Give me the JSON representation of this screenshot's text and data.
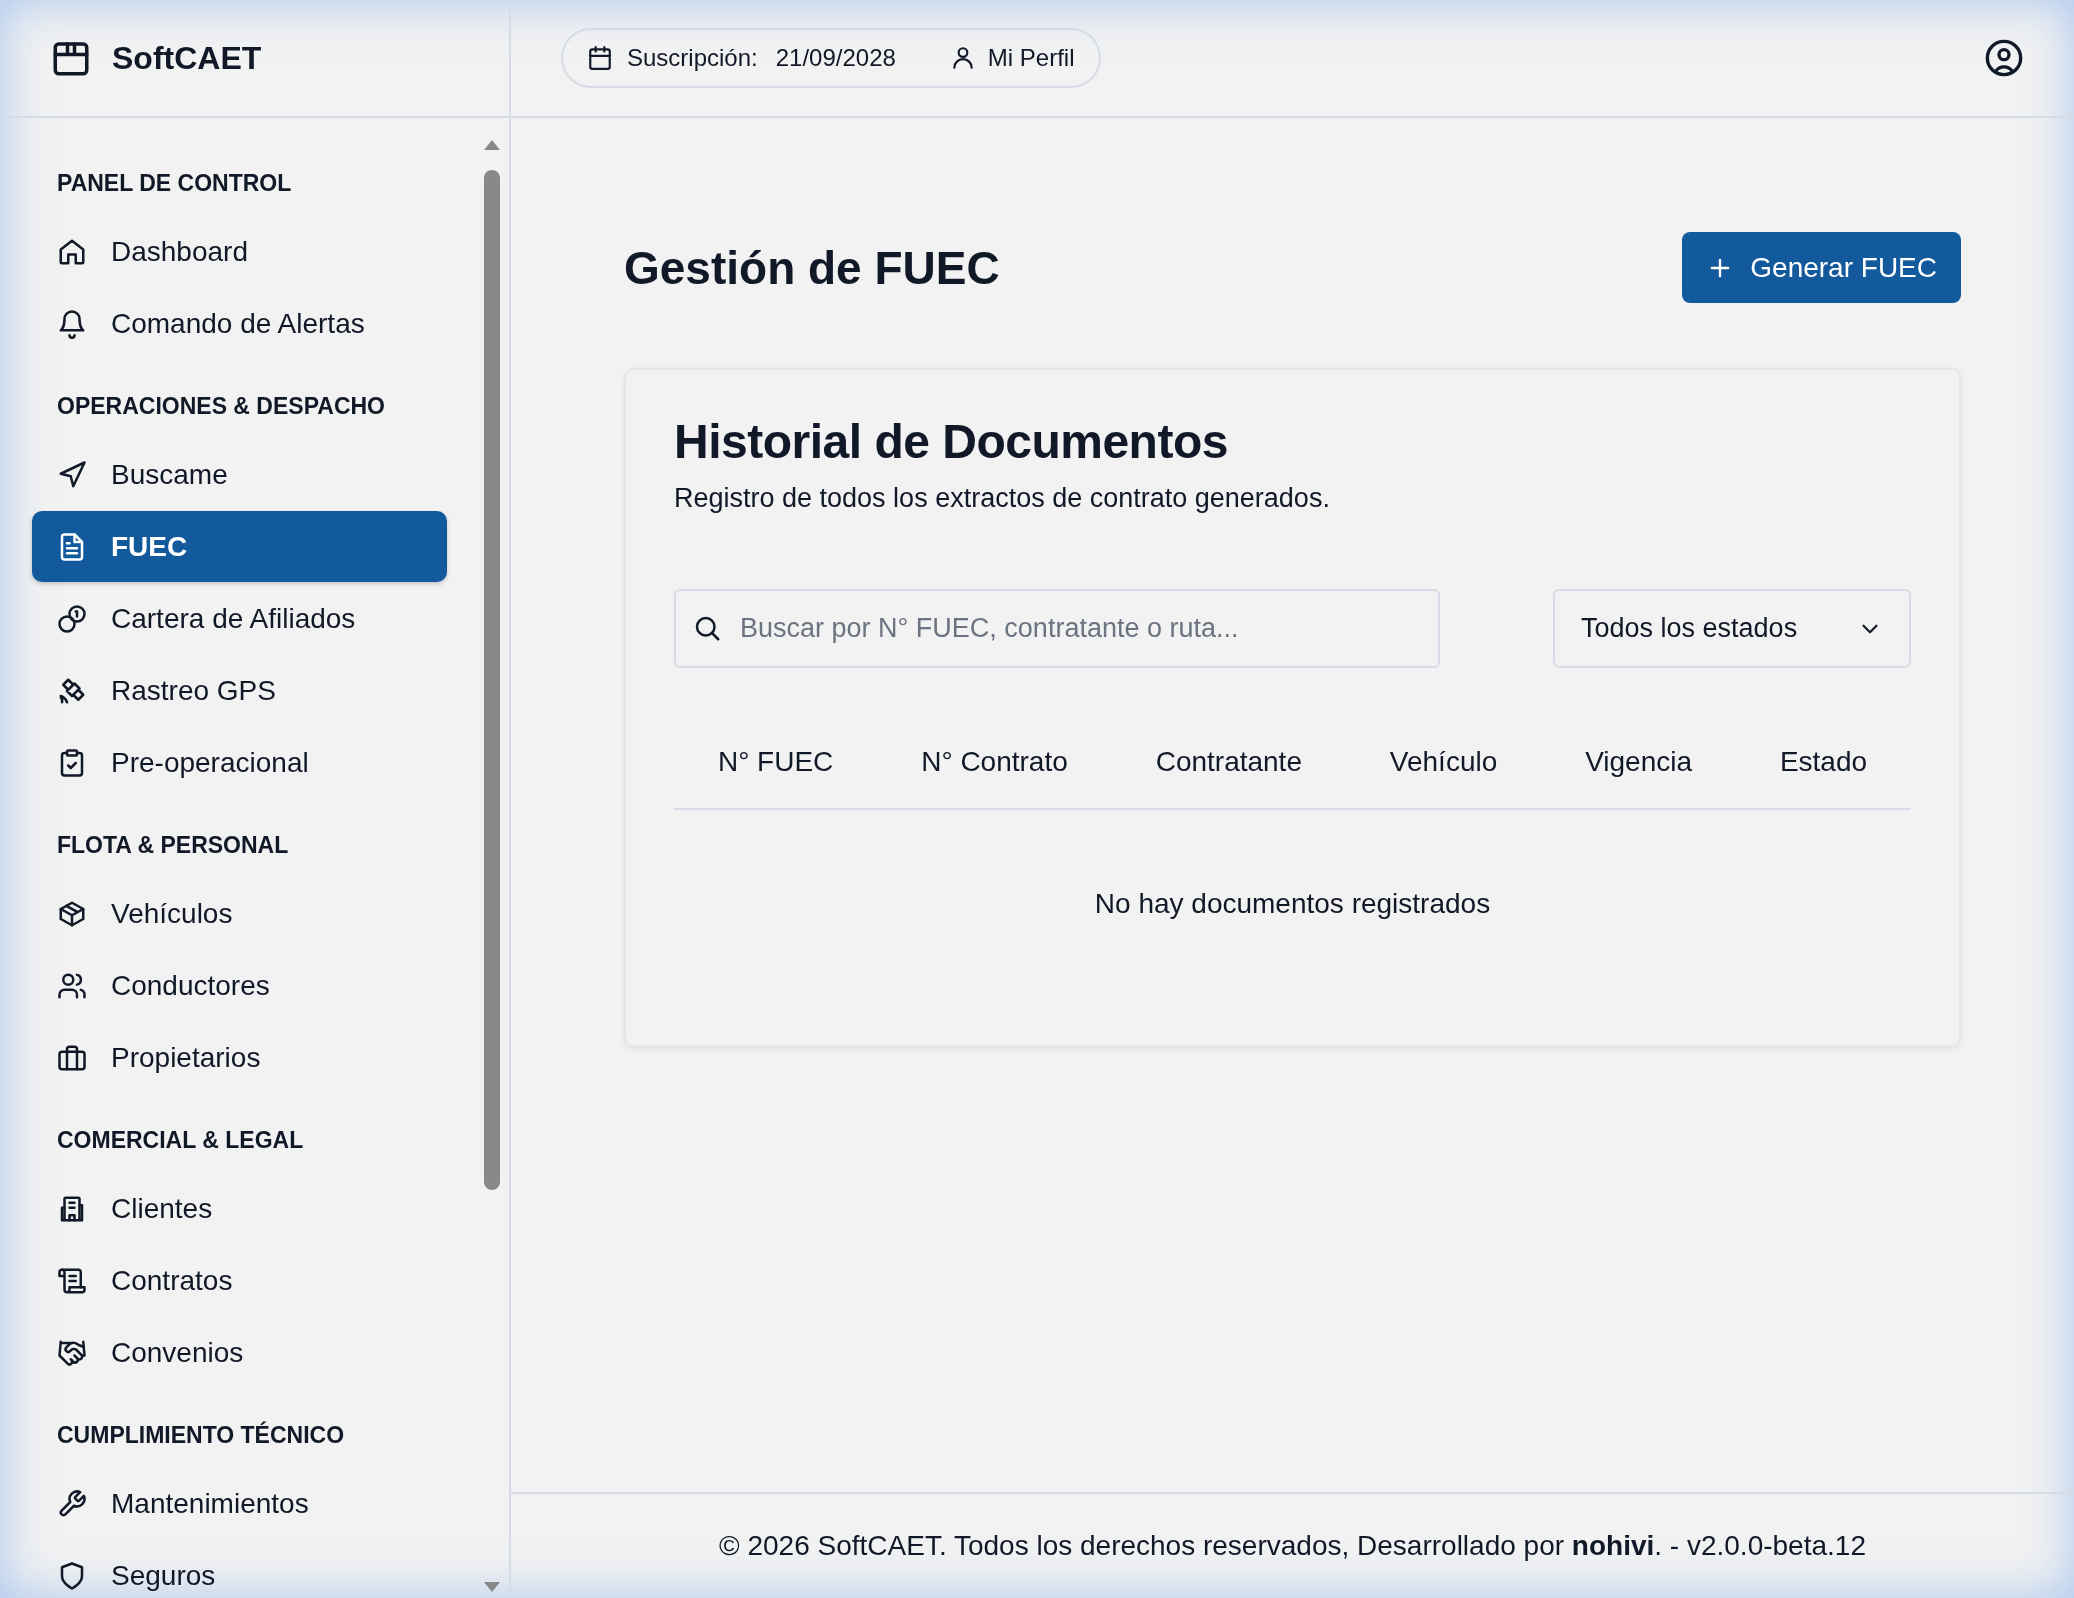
{
  "brand": {
    "name": "SoftCAET"
  },
  "header": {
    "subscription_label": "Suscripción:",
    "subscription_date": "21/09/2028",
    "profile_link": "Mi Perfil"
  },
  "sidebar": {
    "sections": [
      {
        "title": "PANEL DE CONTROL",
        "items": [
          {
            "label": "Dashboard",
            "selected": false
          },
          {
            "label": "Comando de Alertas",
            "selected": false
          }
        ]
      },
      {
        "title": "OPERACIONES & DESPACHO",
        "items": [
          {
            "label": "Buscame",
            "selected": false
          },
          {
            "label": "FUEC",
            "selected": true
          },
          {
            "label": "Cartera de Afiliados",
            "selected": false
          },
          {
            "label": "Rastreo GPS",
            "selected": false
          },
          {
            "label": "Pre-operacional",
            "selected": false
          }
        ]
      },
      {
        "title": "FLOTA & PERSONAL",
        "items": [
          {
            "label": "Vehículos",
            "selected": false
          },
          {
            "label": "Conductores",
            "selected": false
          },
          {
            "label": "Propietarios",
            "selected": false
          }
        ]
      },
      {
        "title": "COMERCIAL & LEGAL",
        "items": [
          {
            "label": "Clientes",
            "selected": false
          },
          {
            "label": "Contratos",
            "selected": false
          },
          {
            "label": "Convenios",
            "selected": false
          }
        ]
      },
      {
        "title": "CUMPLIMIENTO TÉCNICO",
        "items": [
          {
            "label": "Mantenimientos",
            "selected": false
          },
          {
            "label": "Seguros",
            "selected": false
          }
        ]
      }
    ]
  },
  "page": {
    "title": "Gestión de FUEC",
    "primary_button": "Generar FUEC"
  },
  "card": {
    "title": "Historial de Documentos",
    "subtitle": "Registro de todos los extractos de contrato generados.",
    "search": {
      "placeholder": "Buscar por N° FUEC, contratante o ruta..."
    },
    "status_filter": {
      "value": "Todos los estados"
    },
    "table": {
      "columns": [
        "N° FUEC",
        "N° Contrato",
        "Contratante",
        "Vehículo",
        "Vigencia",
        "Estado"
      ],
      "empty_message": "No hay documentos registrados"
    }
  },
  "footer": {
    "text": "© 2026 SoftCAET. Todos los derechos reservados, Desarrollado por **nohivi**. - v2.0.0-beta.12"
  }
}
